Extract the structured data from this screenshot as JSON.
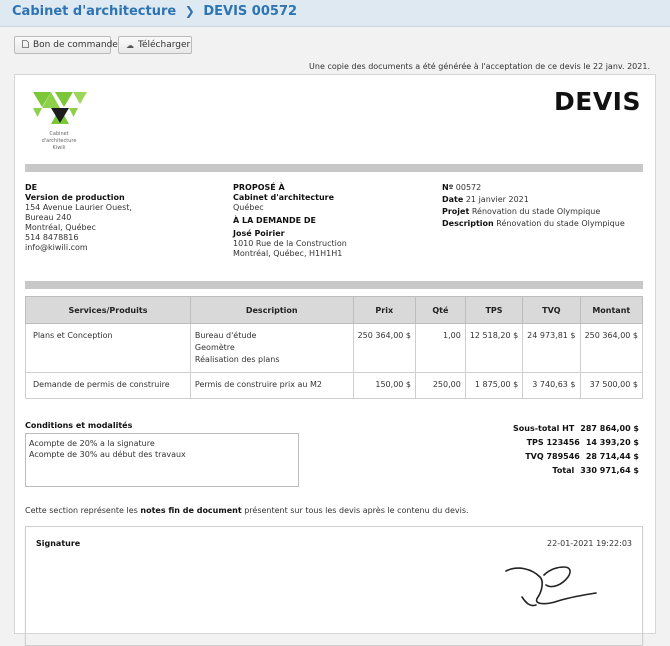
{
  "breadcrumb": {
    "parent": "Cabinet d'architecture",
    "current": "DEVIS 00572"
  },
  "toolbar": {
    "order_label": "Bon de commande",
    "download_label": "Télécharger"
  },
  "notice": "Une copie des documents a été générée à l'acceptation de ce devis le 22 janv. 2021.",
  "document": {
    "title": "DEVIS",
    "logo": {
      "caption_line1": "Cabinet",
      "caption_line2": "d'architecture",
      "caption_line3": "Kiwili"
    },
    "from": {
      "heading": "DE",
      "name": "Version de production",
      "address1": "154 Avenue Laurier Ouest,",
      "address2": "Bureau 240",
      "city": "Montréal, Québec",
      "phone": "514 8478816",
      "email": "info@kiwili.com"
    },
    "proposed": {
      "heading": "PROPOSÉ À",
      "name": "Cabinet d'architecture",
      "region": "Québec",
      "request_heading": "À LA DEMANDE DE",
      "contact": "José Poirier",
      "address": "1010 Rue de la Construction",
      "city": "Montréal, Québec, H1H1H1"
    },
    "meta": {
      "number_label": "Nº",
      "number": "00572",
      "date_label": "Date",
      "date": "21 janvier 2021",
      "project_label": "Projet",
      "project": "Rénovation du stade Olympique",
      "description_label": "Description",
      "description": "Rénovation du stade Olympique"
    },
    "table": {
      "headers": [
        "Services/Produits",
        "Description",
        "Prix",
        "Qté",
        "TPS",
        "TVQ",
        "Montant"
      ],
      "rows": [
        {
          "service": "Plans et Conception",
          "desc1": "Bureau d'étude",
          "desc2": "Geomètre",
          "desc3": "Réalisation des plans",
          "price": "250 364,00 $",
          "qty": "1,00",
          "tps": "12 518,20 $",
          "tvq": "24 973,81 $",
          "amount": "250 364,00 $"
        },
        {
          "service": "Demande de permis de construire",
          "desc1": "Permis de construire prix au M2",
          "price": "150,00 $",
          "qty": "250,00",
          "tps": "1 875,00 $",
          "tvq": "3 740,63 $",
          "amount": "37 500,00 $"
        }
      ]
    },
    "conditions": {
      "title": "Conditions et modalités",
      "line1": "Acompte de 20% a la signature",
      "line2": "Acompte de 30% au début des travaux"
    },
    "totals": {
      "subtotal_label": "Sous-total HT",
      "subtotal": "287 864,00 $",
      "tps_label": "TPS 123456",
      "tps": "14 393,20 $",
      "tvq_label": "TVQ 789546",
      "tvq": "28 714,44 $",
      "total_label": "Total",
      "total": "330 971,64 $"
    },
    "endnote": {
      "before": "Cette section représente les ",
      "bold": "notes fin de document",
      "after": " présentent sur tous les devis après le contenu du devis."
    },
    "signature": {
      "label": "Signature",
      "datetime": "22-01-2021 19:22:03"
    }
  },
  "colors": {
    "accent": "#2d74b3",
    "logo_green": "#7cc63a",
    "logo_dark": "#1c1c1c"
  }
}
